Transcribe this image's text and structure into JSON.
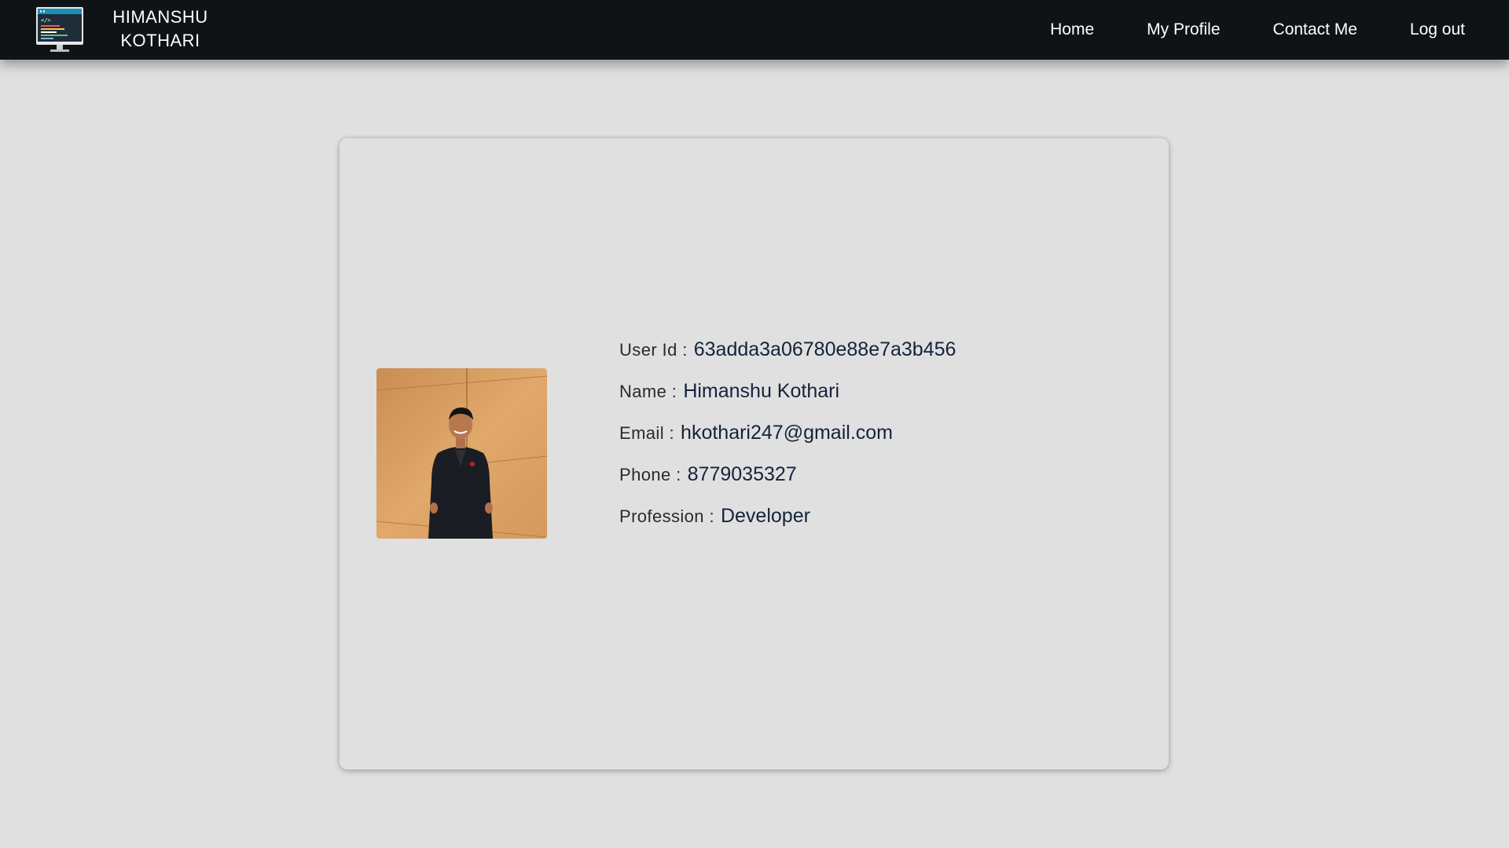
{
  "header": {
    "brand_line1": "HIMANSHU",
    "brand_line2": "KOTHARI",
    "logo_icon": "computer-monitor-code-icon",
    "nav": [
      {
        "label": "Home"
      },
      {
        "label": "My Profile"
      },
      {
        "label": "Contact Me"
      },
      {
        "label": "Log out"
      }
    ]
  },
  "profile": {
    "photo_icon": "profile-photo",
    "user_id_label": "User Id :",
    "user_id": "63adda3a06780e88e7a3b456",
    "name_label": "Name :",
    "name": "Himanshu Kothari",
    "email_label": "Email :",
    "email": "hkothari247@gmail.com",
    "phone_label": "Phone :",
    "phone": "8779035327",
    "profession_label": "Profession :",
    "profession": "Developer"
  },
  "colors": {
    "navbar_bg": "#0f1316",
    "page_bg": "#e0e0e0",
    "value_text": "#14233a"
  }
}
